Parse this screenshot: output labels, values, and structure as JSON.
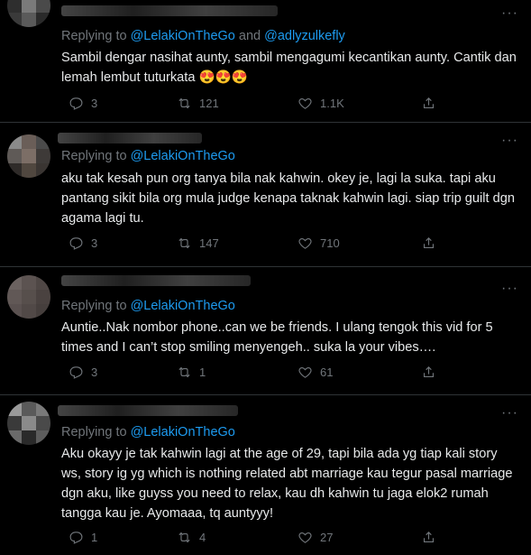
{
  "tweets": [
    {
      "replying_prefix": "Replying to",
      "mention1": "@LelakiOnTheGo",
      "joiner": "and",
      "mention2": "@adlyzulkefly",
      "text_main": "Sambil dengar nasihat aunty, sambil mengagumi kecantikan aunty. Cantik dan lemah lembut tuturkata",
      "emoji": "😍😍😍",
      "replies": "3",
      "retweets": "121",
      "likes": "1.1K",
      "avatar_colors": [
        "#5b5b5b",
        "#3b3b3b",
        "#6e6e6e",
        "#2e2e2e",
        "#7a7a7a",
        "#4a4a4a",
        "#3a3a3a",
        "#5a5a5a",
        "#2a2a2a"
      ]
    },
    {
      "replying_prefix": "Replying to",
      "mention1": "@LelakiOnTheGo",
      "text": "aku tak kesah pun org tanya bila nak kahwin. okey je, lagi la suka. tapi aku pantang sikit bila org mula judge kenapa taknak kahwin lagi. siap trip guilt dgn agama lagi tu.",
      "replies": "3",
      "retweets": "147",
      "likes": "710",
      "avatar_colors": [
        "#8a8a8a",
        "#6a5e58",
        "#4a4a4a",
        "#5f5a57",
        "#7c6e66",
        "#3e3a38",
        "#2f2b29",
        "#50473f",
        "#3a3532"
      ]
    },
    {
      "replying_prefix": "Replying to",
      "mention1": "@LelakiOnTheGo",
      "text": "Auntie..Nak nombor phone..can we be friends. I ulang tengok this vid for 5 times and I can’t stop smiling menyengeh.. suka la your vibes….",
      "replies": "3",
      "retweets": "1",
      "likes": "61",
      "avatar_colors": [
        "#6b6260",
        "#5c5351",
        "#4f4745",
        "#615856",
        "#574f4c",
        "#4a4240",
        "#5a5150",
        "#514947",
        "#463f3d"
      ]
    },
    {
      "replying_prefix": "Replying to",
      "mention1": "@LelakiOnTheGo",
      "text": "Aku okayy je tak kahwin lagi at the age of 29, tapi bila ada yg tiap kali story ws, story ig yg which is nothing related abt marriage kau tegur pasal marriage dgn aku, like guyss you need to relax, kau dh kahwin tu jaga elok2 rumah tangga kau je. Ayomaaa, tq auntyyy!",
      "replies": "1",
      "retweets": "4",
      "likes": "27",
      "avatar_colors": [
        "#9a9a9a",
        "#5a5a5a",
        "#7a7a7a",
        "#3a3a3a",
        "#8a8a8a",
        "#4a4a4a",
        "#6a6a6a",
        "#2a2a2a",
        "#5d5d5d"
      ]
    }
  ]
}
